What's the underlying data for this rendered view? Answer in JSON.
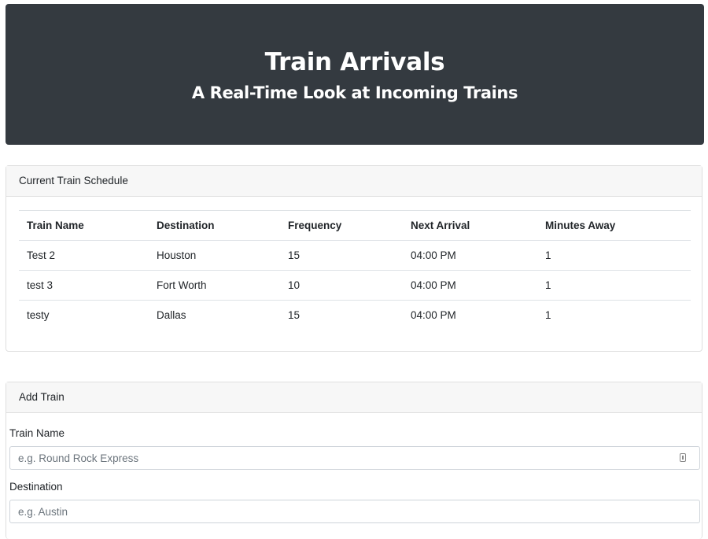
{
  "hero": {
    "title": "Train Arrivals",
    "subtitle": "A Real-Time Look at Incoming Trains"
  },
  "schedule": {
    "header": "Current Train Schedule",
    "columns": [
      "Train Name",
      "Destination",
      "Frequency",
      "Next Arrival",
      "Minutes Away"
    ],
    "rows": [
      [
        "Test 2",
        "Houston",
        "15",
        "04:00 PM",
        "1"
      ],
      [
        "test 3",
        "Fort Worth",
        "10",
        "04:00 PM",
        "1"
      ],
      [
        "testy",
        "Dallas",
        "15",
        "04:00 PM",
        "1"
      ]
    ]
  },
  "add_train": {
    "header": "Add Train",
    "fields": [
      {
        "label": "Train Name",
        "placeholder": "e.g. Round Rock Express"
      },
      {
        "label": "Destination",
        "placeholder": "e.g. Austin"
      }
    ]
  },
  "icons": {
    "field_icon": "password-manager-icon"
  }
}
